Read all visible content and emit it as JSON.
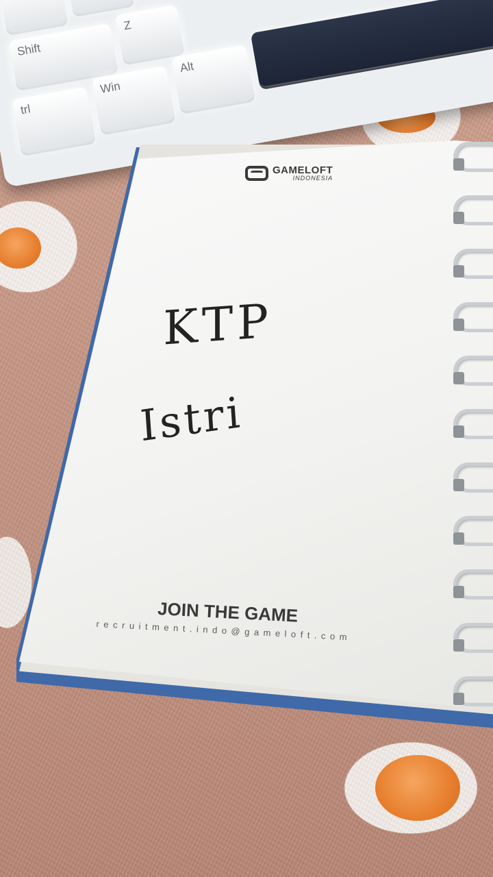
{
  "keyboard": {
    "keys": {
      "shift": "Shift",
      "z": "Z",
      "ctrl": "trl",
      "win": "Win",
      "alt": "Alt"
    }
  },
  "notebook": {
    "logo": {
      "name": "GAMELOFT",
      "sub": "INDONESIA"
    },
    "handwritten": [
      "KTP",
      "Istri"
    ],
    "footer": {
      "title": "JOIN THE GAME",
      "email": "recruitment.indo@gameloft.com"
    }
  },
  "colors": {
    "blanket": "#c79886",
    "flower_center": "#e77f2e",
    "cover": "#3f69a8",
    "space_key": "#1c2436"
  }
}
